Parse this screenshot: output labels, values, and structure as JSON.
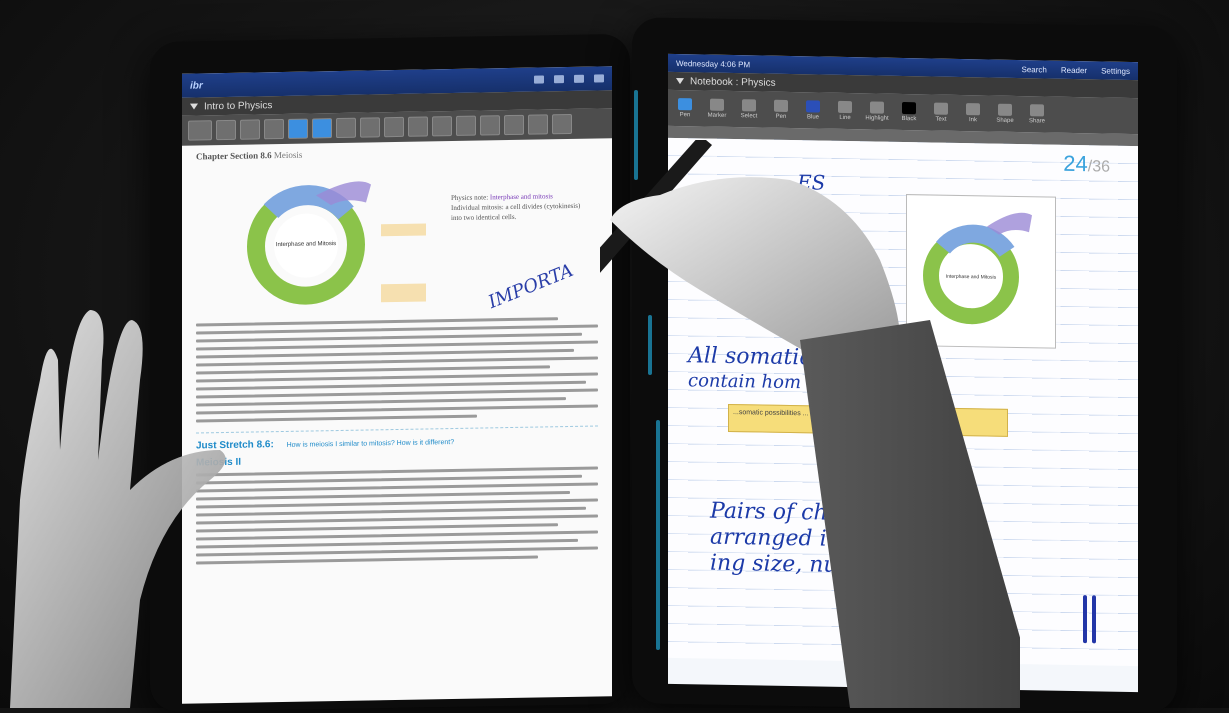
{
  "colors": {
    "status_bar": "#1f3f8a",
    "toolbar": "#4d4d4d",
    "accent_blue": "#3ba3dd",
    "ink": "#1c3aa8",
    "sticky": "#f6dd7a"
  },
  "left": {
    "app_logo": "ibr",
    "doc_title": "Intro to Physics",
    "chapter": "Chapter Section 8.6",
    "chapter_sub": "Meiosis",
    "figure_center": "Interphase and Mitosis",
    "side_note_title": "Physics note:",
    "side_note_purple": "Interphase and mitosis",
    "side_note_body": "Individual mitosis: a cell divides (cytokinesis) into two identical cells. ",
    "section_head": "Just Stretch 8.6:",
    "section_q": "How is meiosis I similar to mitosis? How is it different?",
    "meiosis_head": "Meiosis II"
  },
  "right": {
    "status_time": "Wednesday 4:06 PM",
    "status_items": [
      "Search",
      "Reader",
      "Settings"
    ],
    "notebook_title": "Notebook : Physics",
    "tools": [
      {
        "label": "Pen",
        "state": "active"
      },
      {
        "label": "Marker"
      },
      {
        "label": "Select"
      },
      {
        "label": "Pen"
      },
      {
        "label": "Blue",
        "color": "blue"
      },
      {
        "label": "Line"
      },
      {
        "label": "Highlight"
      },
      {
        "label": "Black",
        "color": "black"
      },
      {
        "label": "Text"
      },
      {
        "label": "Ink"
      },
      {
        "label": "Shape"
      },
      {
        "label": "Share"
      }
    ],
    "page_current": "24",
    "page_total": "/36",
    "hw_title": "...ES",
    "hw_line1": "All somatic",
    "hw_line2": "contain hom",
    "hw_line3": "Pairs of chrom",
    "hw_line4": "arranged in or",
    "hw_line5": "ing size, nu",
    "sticky_text": "...somatic possibilities ... physical and as ... check whether the ... "
  },
  "floating_text": "IMPORTA"
}
